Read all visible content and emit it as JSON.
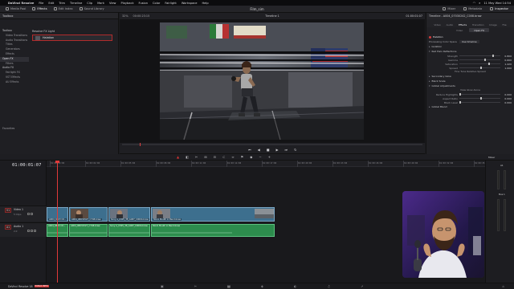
{
  "menubar": {
    "app_name": "DaVinci Resolve",
    "items": [
      "File",
      "Edit",
      "Trim",
      "Timeline",
      "Clip",
      "Mark",
      "View",
      "Playback",
      "Fusion",
      "Color",
      "Fairlight",
      "Workspace",
      "Help"
    ],
    "clock": "11 May Wed 14:54"
  },
  "toolbar": {
    "media_pool": "Media Pool",
    "effects": "Effects",
    "edit_index": "Edit Index",
    "sound_library": "Sound Library",
    "project_title": "Film_sim",
    "mixer": "Mixer",
    "metadata": "Metadata",
    "inspector": "Inspector"
  },
  "effects_panel": {
    "title": "Toolbox",
    "tree": [
      {
        "label": "Toolbox",
        "level": "parent"
      },
      {
        "label": "Video Transitions",
        "level": "child"
      },
      {
        "label": "Audio Transitions",
        "level": "child"
      },
      {
        "label": "Titles",
        "level": "child"
      },
      {
        "label": "Generators",
        "level": "child"
      },
      {
        "label": "Effects",
        "level": "child"
      },
      {
        "label": "Open FX",
        "level": "parent",
        "selected": true
      },
      {
        "label": "Filters",
        "level": "child"
      },
      {
        "label": "Audio FX",
        "level": "parent"
      },
      {
        "label": "Fairlight FX",
        "level": "child"
      },
      {
        "label": "VST Effects",
        "level": "child"
      },
      {
        "label": "AU Effects",
        "level": "child"
      }
    ],
    "group_label": "Resolve FX Light",
    "selected_effect": "Halation",
    "favorites": "Favorites"
  },
  "viewer": {
    "zoom": "32%",
    "source_timecode": "00:00:23:15",
    "timeline_name": "Timeline 1",
    "record_timecode": "01:00:01:07"
  },
  "inspector": {
    "clip_name": "Timeline - A004_07030242_C008.braw",
    "tabs": [
      "Video",
      "Audio",
      "Effects",
      "Transition",
      "Image",
      "File"
    ],
    "active_tab": "Effects",
    "subtabs": [
      "Video",
      "Open FX"
    ],
    "active_subtab": "Open FX",
    "effect_name": "Halation",
    "processing_label": "Processing Color Space",
    "processing_value": "Use timeline",
    "sections": {
      "isolation": "Isolation",
      "red_halo": "Red Halo Reflections",
      "secondary_glow": "Secondary Glow",
      "black_scale": "Black Scale",
      "global_adjustments": "Global Adjustments",
      "global_blend": "Global Blend"
    },
    "halo_params": [
      {
        "name": "Strength",
        "value": "0.800",
        "level": 0.8
      },
      {
        "name": "Gamma",
        "value": "0.600",
        "level": 0.6
      },
      {
        "name": "Saturation",
        "value": "1.420",
        "level": 0.71
      },
      {
        "name": "Spread",
        "value": "1.000",
        "level": 0.5
      }
    ],
    "fine_tune_label": "Fine Tune Relative Spread",
    "glow_label": "View Glow Alone",
    "global_params": [
      {
        "name": "Reduce Highlights",
        "value": "0.000",
        "level": 0.0
      },
      {
        "name": "Aspect Ratio",
        "value": "0.000",
        "level": 0.5
      },
      {
        "name": "Black Level",
        "value": "0.000",
        "level": 0.0
      }
    ]
  },
  "timeline": {
    "current_timecode": "01:00:01:07",
    "ruler_ticks": [
      "01:00:00:00",
      "01:00:02:00",
      "01:00:05:00",
      "01:00:08:00",
      "01:00:11:00",
      "01:00:14:00",
      "01:00:17:00",
      "01:00:20:00",
      "01:00:23:00",
      "01:00:26:00",
      "01:00:29:00",
      "01:00:32:00",
      "01:00:35:00"
    ],
    "video_track": {
      "id": "V1",
      "name": "Video 1",
      "count": "5 Clips"
    },
    "audio_track": {
      "id": "A1",
      "name": "Audio 1",
      "count": "2.0"
    },
    "video_clips": [
      {
        "label": "A004_0803 C0..."
      },
      {
        "label": "A004_08031527_C748.braw"
      },
      {
        "label": "Sony A_0305_38_G487_C0004.braw"
      },
      {
        "label": "Stock Mouth in Bend.braw"
      }
    ],
    "audio_clips": [
      {
        "label": "A004_0803 C0..."
      },
      {
        "label": "A004_08031527_C748.braw"
      },
      {
        "label": "Sony A_0305_38_G487_C0004.braw"
      },
      {
        "label": "Stock Mouth in Bend.braw"
      }
    ],
    "mixer_title": "Mixer",
    "mixer_a1": "A1",
    "mixer_bus": "Bus 1"
  },
  "pagebar": {
    "brand": "DaVinci Resolve 18",
    "beta": "PUBLIC BETA"
  },
  "colors": {
    "video_clip": "#3d6f8e",
    "audio_clip": "#2d8c4d",
    "playhead": "#e03a3a",
    "selection": "#b12c2c"
  }
}
